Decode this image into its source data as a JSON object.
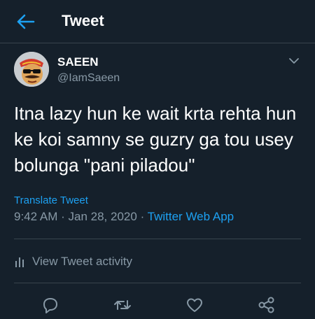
{
  "header": {
    "title": "Tweet",
    "back_icon": "arrow-left-icon",
    "accent_color": "#1da1f2"
  },
  "tweet": {
    "author_name": "SAEEN",
    "author_handle": "@IamSaeen",
    "text": "Itna lazy hun ke wait krta rehta hun ke koi samny se guzry ga tou usey bolunga \"pani piladou\"",
    "translate_label": "Translate Tweet",
    "time": "9:42 AM",
    "date": "Jan 28, 2020",
    "separator": "·",
    "source": "Twitter Web App",
    "more_icon": "chevron-down-icon"
  },
  "activity": {
    "label": "View Tweet activity",
    "icon": "bar-chart-icon"
  },
  "actions": [
    {
      "name": "reply",
      "icon": "comment-icon"
    },
    {
      "name": "retweet",
      "icon": "retweet-icon"
    },
    {
      "name": "like",
      "icon": "heart-icon"
    },
    {
      "name": "share",
      "icon": "share-icon"
    }
  ],
  "colors": {
    "background": "#15202b",
    "border": "#38444d",
    "secondary_text": "#8899a6",
    "link": "#1da1f2"
  }
}
